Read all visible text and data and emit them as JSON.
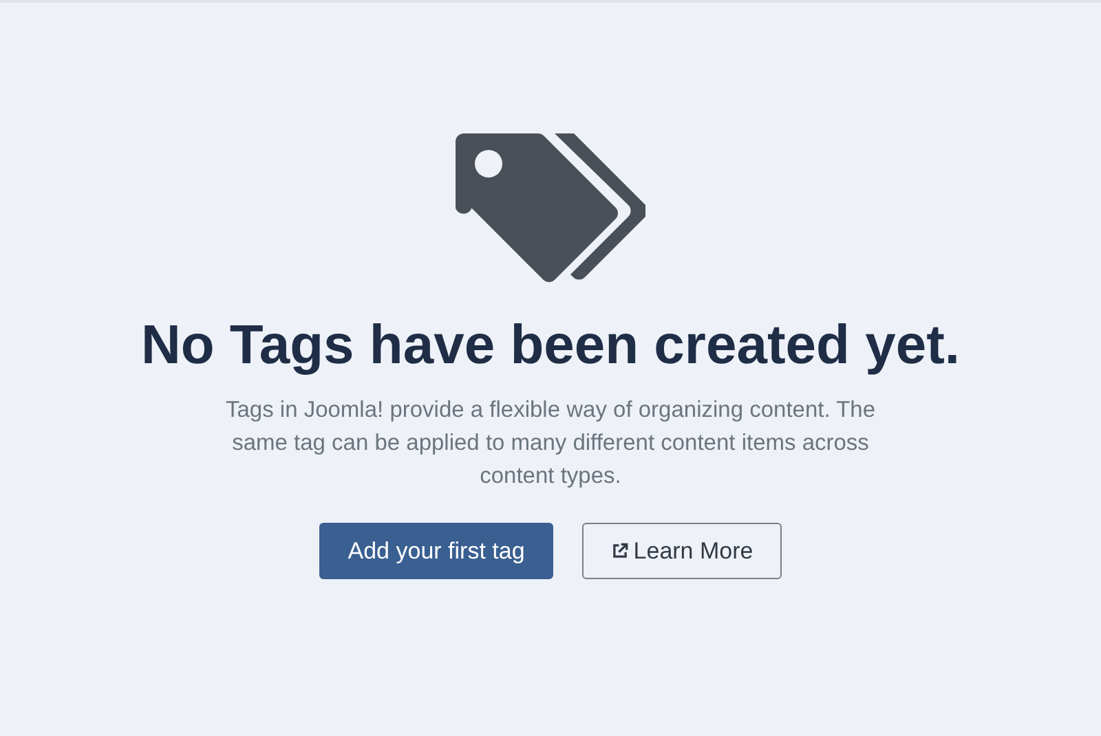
{
  "empty_state": {
    "title": "No Tags have been created yet.",
    "description": "Tags in Joomla! provide a flexible way of organizing content. The same tag can be applied to many different content items across content types.",
    "buttons": [
      {
        "label": "Add your first tag",
        "kind": "primary"
      },
      {
        "label": "Learn More",
        "kind": "external"
      }
    ]
  }
}
